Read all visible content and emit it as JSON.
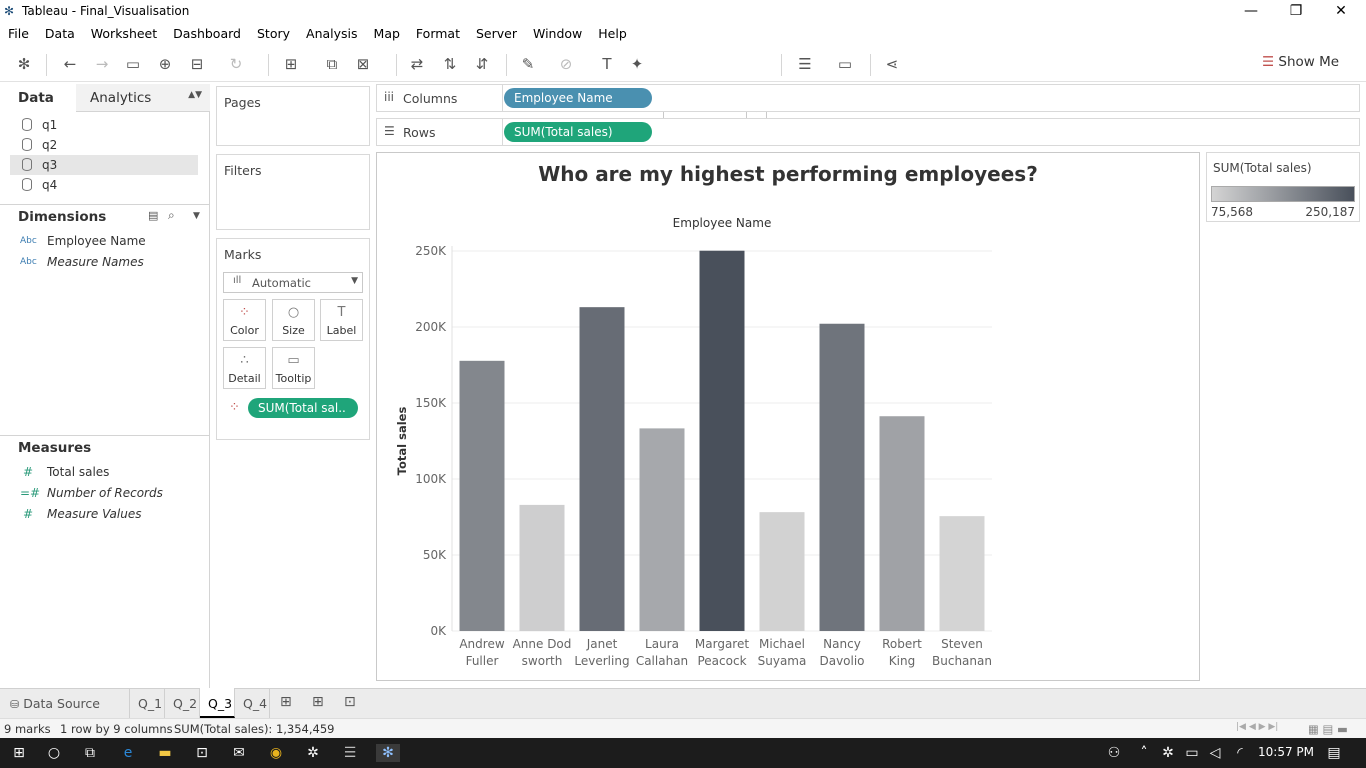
{
  "window": {
    "title": "Tableau - Final_Visualisation",
    "minimize": "—",
    "restore": "❐",
    "close": "✕"
  },
  "menu": [
    "File",
    "Data",
    "Worksheet",
    "Dashboard",
    "Story",
    "Analysis",
    "Map",
    "Format",
    "Server",
    "Window",
    "Help"
  ],
  "toolbar": {
    "fit_select": "Standard",
    "show_me": "Show Me"
  },
  "data_pane": {
    "tab_data": "Data",
    "tab_analytics": "Analytics",
    "sources": [
      "q1",
      "q2",
      "q3",
      "q4"
    ],
    "selected_source": "q3",
    "dimensions_label": "Dimensions",
    "dimensions": [
      {
        "prefix": "Abc",
        "name": "Employee Name",
        "italic": false
      },
      {
        "prefix": "Abc",
        "name": "Measure Names",
        "italic": true
      }
    ],
    "measures_label": "Measures",
    "measures": [
      {
        "name": "Total sales",
        "italic": false
      },
      {
        "name": "Number of Records",
        "italic": true
      },
      {
        "name": "Measure Values",
        "italic": true
      }
    ]
  },
  "cards": {
    "pages": "Pages",
    "filters": "Filters",
    "marks": "Marks",
    "mark_type": "Automatic",
    "buttons": [
      "Color",
      "Size",
      "Label",
      "Detail",
      "Tooltip"
    ],
    "color_pill": "SUM(Total sal.."
  },
  "shelves": {
    "columns_label": "Columns",
    "columns_pill": "Employee Name",
    "rows_label": "Rows",
    "rows_pill": "SUM(Total sales)"
  },
  "legend": {
    "title": "SUM(Total sales)",
    "min": "75,568",
    "max": "250,187"
  },
  "chart_data": {
    "type": "bar",
    "title": "Who are my highest performing employees?",
    "xlabel": "Employee Name",
    "ylabel": "Total sales",
    "categories": [
      [
        "Andrew",
        "Fuller"
      ],
      [
        "Anne Dod",
        "sworth"
      ],
      [
        "Janet",
        "Leverling"
      ],
      [
        "Laura",
        "Callahan"
      ],
      [
        "Margaret",
        "Peacock"
      ],
      [
        "Michael",
        "Suyama"
      ],
      [
        "Nancy",
        "Davolio"
      ],
      [
        "Robert",
        "King"
      ],
      [
        "Steven",
        "Buchanan"
      ]
    ],
    "values": [
      177750,
      82964,
      213051,
      133301,
      250187,
      78198,
      202143,
      141296,
      75568
    ],
    "ylim": [
      0,
      250000
    ],
    "yticks": [
      0,
      50000,
      100000,
      150000,
      200000,
      250000
    ],
    "ytick_labels": [
      "0K",
      "50K",
      "100K",
      "150K",
      "200K",
      "250K"
    ],
    "color_low": "#d4d4d4",
    "color_high": "#49505b",
    "grid": true
  },
  "sheets": {
    "datasource": "Data Source",
    "tabs": [
      "Q_1",
      "Q_2",
      "Q_3",
      "Q_4"
    ],
    "active": "Q_3"
  },
  "status": {
    "marks": "9 marks",
    "dims": "1 row by 9 columns",
    "sum": "SUM(Total sales): 1,354,459"
  },
  "taskbar": {
    "time": "10:57 PM"
  }
}
